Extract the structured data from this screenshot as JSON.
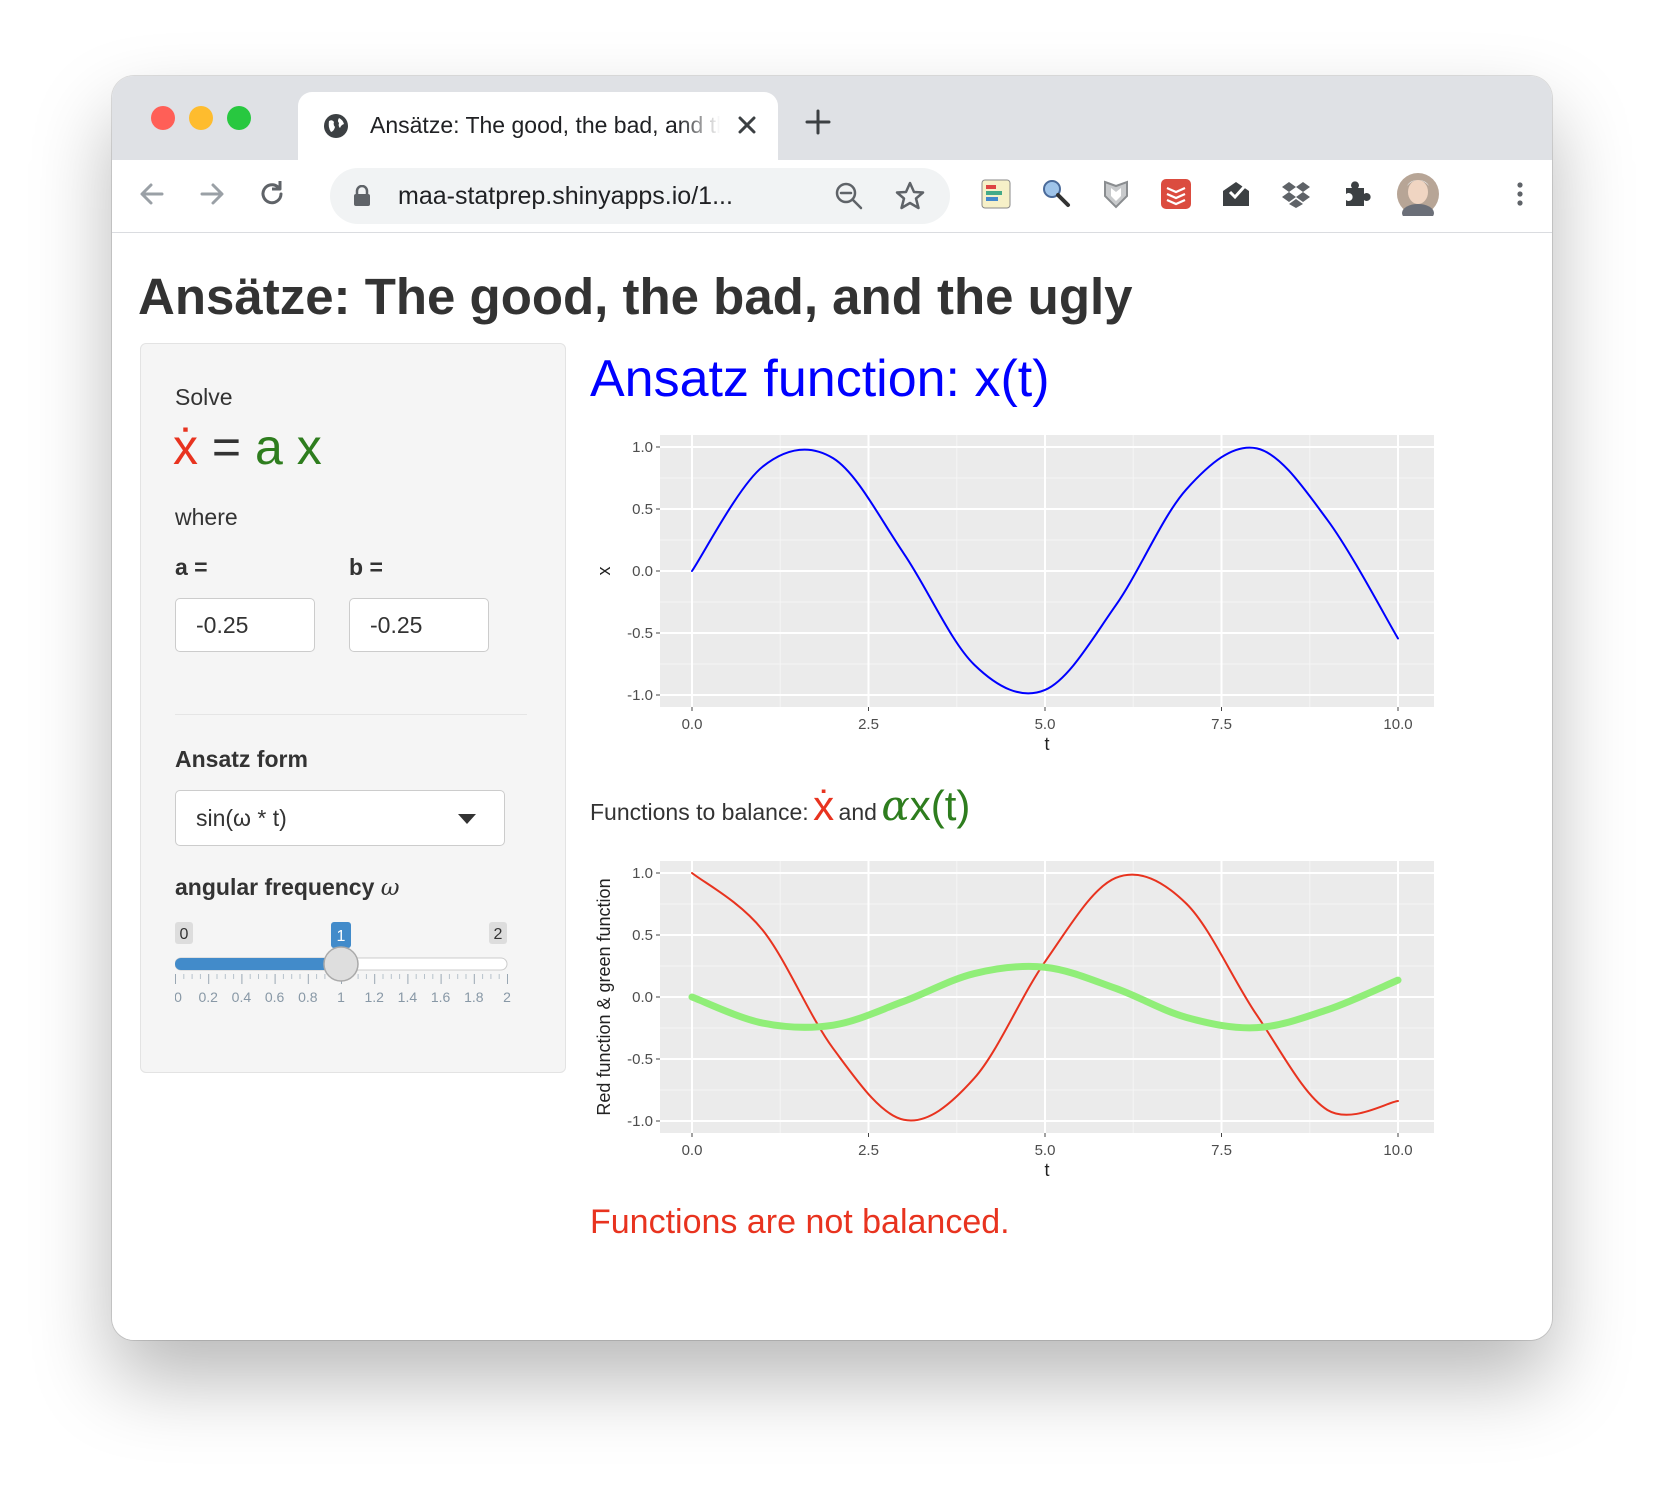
{
  "browser": {
    "tab_title": "Ansätze: The good, the bad, and the ugly",
    "url": "maa-statprep.shinyapps.io/1...",
    "colors": {
      "close": "#ff5f57",
      "minimize": "#febc2e",
      "zoom": "#28c840"
    }
  },
  "page": {
    "title": "Ansätze: The good, the bad, and the ugly",
    "sidebar": {
      "solve_label": "Solve",
      "equation": {
        "xdot": "ẋ",
        "equals": "=",
        "rhs": "a x"
      },
      "where_label": "where",
      "a_label": "a =",
      "b_label": "b =",
      "a_value": "-0.25",
      "b_value": "-0.25",
      "ansatz_label": "Ansatz form",
      "ansatz_selected": "sin(ω * t)",
      "freq_label_text": "angular frequency",
      "freq_label_symbol": "ω",
      "slider": {
        "min_label": "0",
        "max_label": "2",
        "value_label": "1",
        "value": 1,
        "min": 0,
        "max": 2,
        "tick_labels": [
          "0",
          "0.2",
          "0.4",
          "0.6",
          "0.8",
          "1",
          "1.2",
          "1.4",
          "1.6",
          "1.8",
          "2"
        ]
      }
    },
    "main": {
      "ansatz_heading": "Ansatz function: x(t)",
      "balance_prefix": "Functions to balance:",
      "balance_xdot": "ẋ",
      "balance_and": "and",
      "balance_alpha": "α",
      "balance_xt": "x(t)",
      "status_message": "Functions are not balanced."
    },
    "colors": {
      "red": "#e8331f",
      "green": "#2e7d1e",
      "heading_blue": "#0000ff",
      "slider_blue": "#428bca"
    }
  },
  "chart_data": [
    {
      "type": "line",
      "xlabel": "t",
      "ylabel": "x",
      "xlim": [
        0,
        10
      ],
      "ylim": [
        -1,
        1
      ],
      "x_ticks": [
        "0.0",
        "2.5",
        "5.0",
        "7.5",
        "10.0"
      ],
      "y_ticks": [
        "-1.0",
        "-0.5",
        "0.0",
        "0.5",
        "1.0"
      ],
      "grid": true,
      "series": [
        {
          "function": "sin(t)",
          "color": "#0000ff",
          "width": 2,
          "x": [
            0,
            1,
            2,
            3,
            4,
            5,
            6,
            7,
            8,
            9,
            10
          ],
          "values": [
            0,
            0.841,
            0.909,
            0.141,
            -0.757,
            -0.959,
            -0.279,
            0.657,
            0.989,
            0.412,
            -0.544
          ]
        }
      ]
    },
    {
      "type": "line",
      "xlabel": "t",
      "ylabel": "Red function & green function",
      "xlim": [
        0,
        10
      ],
      "ylim": [
        -1,
        1
      ],
      "x_ticks": [
        "0.0",
        "2.5",
        "5.0",
        "7.5",
        "10.0"
      ],
      "y_ticks": [
        "-1.0",
        "-0.5",
        "0.0",
        "0.5",
        "1.0"
      ],
      "grid": true,
      "series": [
        {
          "function": "cos(t)",
          "color": "#e8331f",
          "width": 2,
          "x": [
            0,
            1,
            2,
            3,
            4,
            5,
            6,
            7,
            8,
            9,
            10
          ],
          "values": [
            1,
            0.54,
            -0.416,
            -0.99,
            -0.654,
            0.284,
            0.96,
            0.754,
            -0.146,
            -0.911,
            -0.839
          ]
        },
        {
          "function": "-0.25*sin(t)",
          "color": "#90ee78",
          "width": 7,
          "x": [
            0,
            1,
            2,
            3,
            4,
            5,
            6,
            7,
            8,
            9,
            10
          ],
          "values": [
            0,
            -0.21,
            -0.227,
            -0.035,
            0.189,
            0.24,
            0.07,
            -0.164,
            -0.247,
            -0.103,
            0.136
          ]
        }
      ]
    }
  ]
}
